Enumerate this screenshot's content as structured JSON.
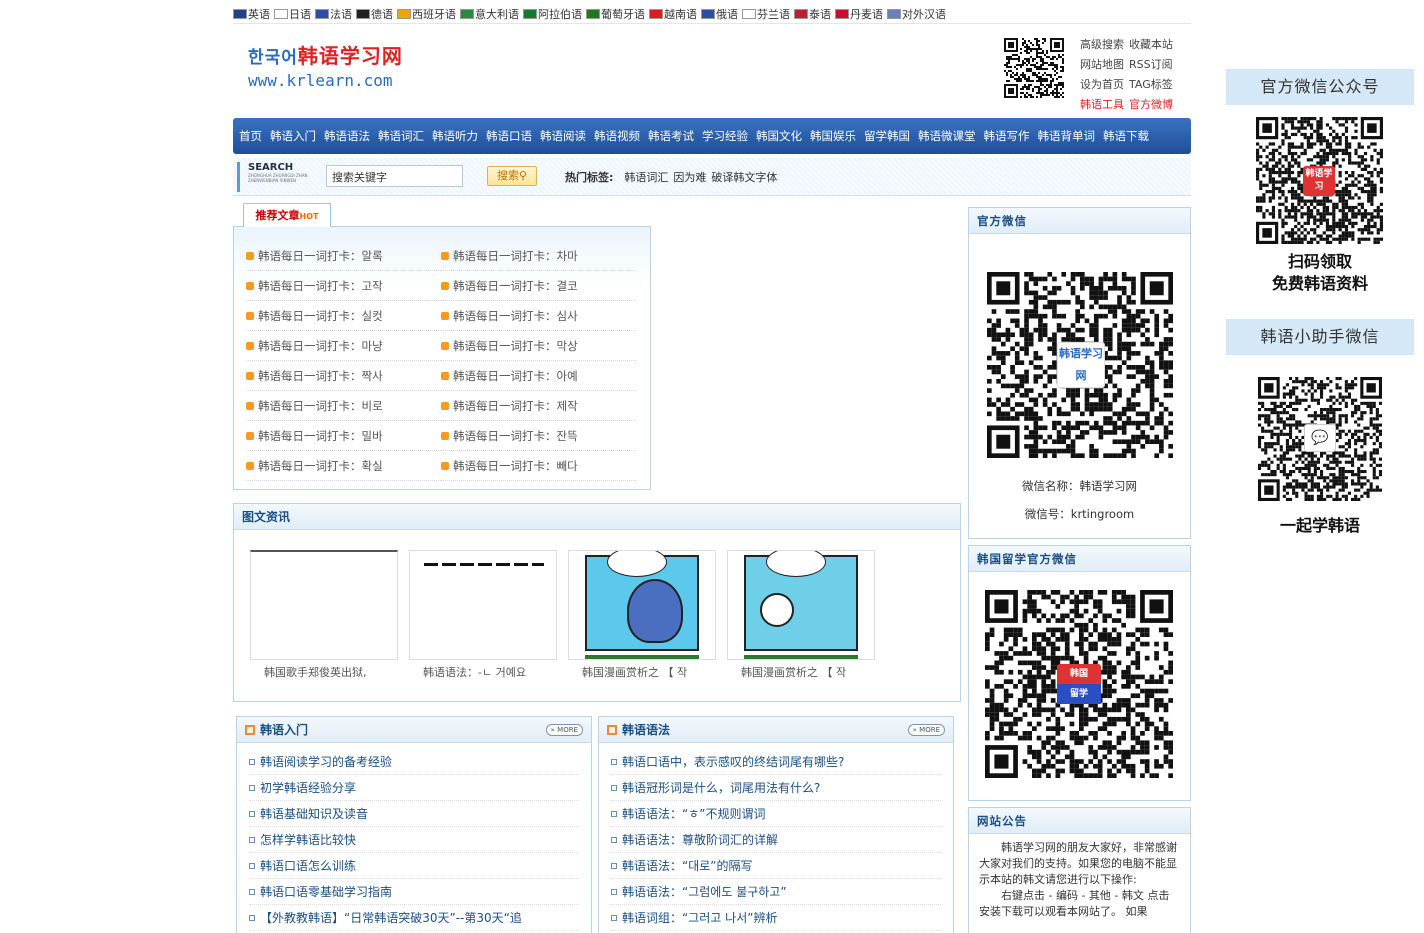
{
  "languages": [
    {
      "label": "英语",
      "flag": "#1f3f8f"
    },
    {
      "label": "日语",
      "flag": "#ffffff"
    },
    {
      "label": "法语",
      "flag": "#2d4fa0"
    },
    {
      "label": "德语",
      "flag": "#222222"
    },
    {
      "label": "西班牙语",
      "flag": "#e8a800"
    },
    {
      "label": "意大利语",
      "flag": "#2b8a3e"
    },
    {
      "label": "阿拉伯语",
      "flag": "#157a2f"
    },
    {
      "label": "葡萄牙语",
      "flag": "#1b7a1b"
    },
    {
      "label": "越南语",
      "flag": "#d62020"
    },
    {
      "label": "俄语",
      "flag": "#2d4fa0"
    },
    {
      "label": "芬兰语",
      "flag": "#ffffff"
    },
    {
      "label": "泰语",
      "flag": "#b8222e"
    },
    {
      "label": "丹麦语",
      "flag": "#c8102e"
    },
    {
      "label": "对外汉语",
      "flag": "#6a7fc0"
    }
  ],
  "logo": {
    "korean": "한국어",
    "chinese": "韩语学习网",
    "url": "www.krlearn.com"
  },
  "header_links": [
    [
      "高级搜索",
      "收藏本站"
    ],
    [
      "网站地图",
      "RSS订阅"
    ],
    [
      "设为首页",
      "TAG标签"
    ],
    [
      "韩语工具",
      "官方微博"
    ]
  ],
  "nav": [
    "首页",
    "韩语入门",
    "韩语语法",
    "韩语词汇",
    "韩语听力",
    "韩语口语",
    "韩语阅读",
    "韩语视频",
    "韩语考试",
    "学习经验",
    "韩国文化",
    "韩国娱乐",
    "留学韩国",
    "韩语微课堂",
    "韩语写作",
    "韩语背单词",
    "韩语下载"
  ],
  "search": {
    "logo_title": "SEARCH",
    "logo_sub": "ZHONGHUA ZHUANGDI ZHAN ZHENWENBIAN XINWEN",
    "value": "搜索关键字",
    "button": "搜索",
    "hot_label": "热门标签:",
    "hot_tags": [
      "韩语词汇",
      "因为难",
      "破译韩文字体"
    ]
  },
  "recommend": {
    "tab": "推荐文章",
    "tab_hot": "HOT",
    "items": [
      "韩语每日一词打卡：알록",
      "韩语每日一词打卡：차마",
      "韩语每日一词打卡：고작",
      "韩语每日一词打卡：결코",
      "韩语每日一词打卡：실컷",
      "韩语每日一词打卡：심사",
      "韩语每日一词打卡：마냥",
      "韩语每日一词打卡：막상",
      "韩语每日一词打卡：짝사",
      "韩语每日一词打卡：아예",
      "韩语每日一词打卡：비로",
      "韩语每日一词打卡：제작",
      "韩语每日一词打卡：밀바",
      "韩语每日一词打卡：잔뜩",
      "韩语每日一词打卡：확실",
      "韩语每日一词打卡：빼다"
    ]
  },
  "image_news": {
    "title": "图文资讯",
    "items": [
      {
        "caption": "韩国歌手郑俊英出狱,"
      },
      {
        "caption": "韩语语法：-ㄴ 거예요"
      },
      {
        "caption": "韩国漫画赏析之 【 작"
      },
      {
        "caption": "韩国漫画赏析之 【 작"
      }
    ]
  },
  "col_intro": {
    "title": "韩语入门",
    "more": "MORE",
    "items": [
      "韩语阅读学习的备考经验",
      "初学韩语经验分享",
      "韩语基础知识及读音",
      "怎样学韩语比较快",
      "韩语口语怎么训练",
      "韩语口语零基础学习指南",
      "【外教教韩语】“日常韩语突破30天”--第30天“追"
    ]
  },
  "col_grammar": {
    "title": "韩语语法",
    "more": "MORE",
    "items": [
      "韩语口语中，表示感叹的终结词尾有哪些?",
      "韩语冠形词是什么，词尾用法有什么?",
      "韩语语法：“ㅎ”不规则谓词",
      "韩语语法：尊敬阶词汇的详解",
      "韩语语法：“대로”的隔写",
      "韩语语法：“그럼에도 불구하고”",
      "韩语词组：“그러고 나서”辨析"
    ]
  },
  "side_wechat": {
    "title": "官方微信",
    "badge": "韩语学习网",
    "name": "微信名称：韩语学习网",
    "id": "微信号：krtingroom"
  },
  "side_study": {
    "title": "韩国留学官方微信",
    "badge_top": "韩国",
    "badge_bottom": "留学"
  },
  "side_notice": {
    "title": "网站公告",
    "para1": "韩语学习网的朋友大家好，非常感谢大家对我们的支持。如果您的电脑不能显示本站的韩文请您进行以下操作:",
    "para2": "右键点击 - 编码 - 其他 - 韩文 点击安装下载可以观看本网站了。 如果"
  },
  "float": {
    "title1": "官方微信公众号",
    "badge1": "韩语学习",
    "cap1a": "扫码领取",
    "cap1b": "免费韩语资料",
    "title2": "韩语小助手微信",
    "cap2": "一起学韩语"
  }
}
